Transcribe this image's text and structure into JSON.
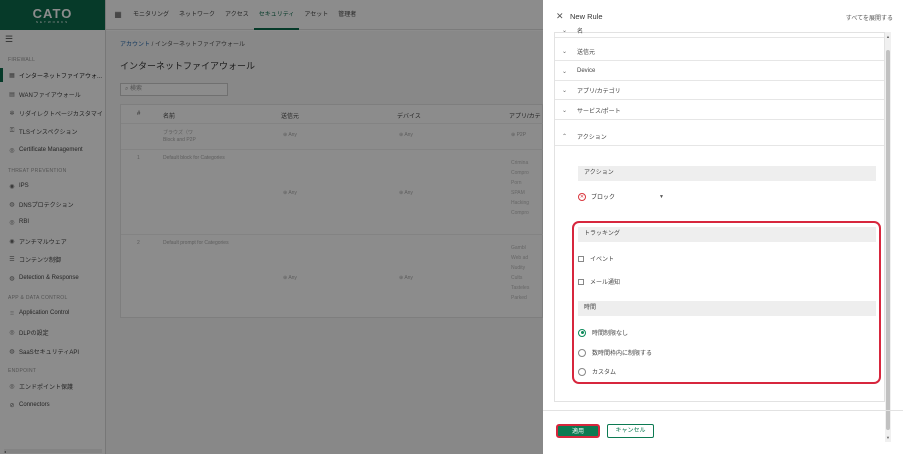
{
  "logo": {
    "name": "CATO",
    "tagline": "NETWORKS"
  },
  "topnav": [
    "モニタリング",
    "ネットワーク",
    "アクセス",
    "セキュリティ",
    "アセット",
    "管理者"
  ],
  "sidebar": {
    "sections": [
      "FIREWALL",
      "THREAT PREVENTION",
      "APP & DATA CONTROL",
      "ENDPOINT"
    ],
    "items": [
      {
        "label": "インターネットファイアウォ...",
        "icon": "firewall-icon",
        "glyph": "▦"
      },
      {
        "label": "WANファイアウォール",
        "icon": "wan-firewall-icon",
        "glyph": "▤"
      },
      {
        "label": "リダイレクトページカスタマイ",
        "icon": "gear-icon",
        "glyph": "✲"
      },
      {
        "label": "TLSインスペクション",
        "icon": "lock-icon",
        "glyph": "⚿"
      },
      {
        "label": "Certificate Management",
        "icon": "certificate-icon",
        "glyph": "◎"
      },
      {
        "label": "IPS",
        "icon": "ips-icon",
        "glyph": "◉"
      },
      {
        "label": "DNSプロテクション",
        "icon": "dns-icon",
        "glyph": "◍"
      },
      {
        "label": "RBI",
        "icon": "rbi-icon",
        "glyph": "◎"
      },
      {
        "label": "アンチマルウェア",
        "icon": "shield-icon",
        "glyph": "◉"
      },
      {
        "label": "コンテンツ制御",
        "icon": "list-icon",
        "glyph": "☰"
      },
      {
        "label": "Detection & Response",
        "icon": "detection-icon",
        "glyph": "◍"
      },
      {
        "label": "Application Control",
        "icon": "app-control-icon",
        "glyph": "⁝⁝"
      },
      {
        "label": "DLPの設定",
        "icon": "dlp-icon",
        "glyph": "◎"
      },
      {
        "label": "SaaSセキュリティAPI",
        "icon": "saas-icon",
        "glyph": "◍"
      },
      {
        "label": "エンドポイント保護",
        "icon": "endpoint-icon",
        "glyph": "◎"
      },
      {
        "label": "Connectors",
        "icon": "connectors-icon",
        "glyph": "⊘"
      }
    ]
  },
  "main": {
    "breadcrumb": {
      "root": "アカウント",
      "separator": " / ",
      "current": "インターネットファイアウォール"
    },
    "title": "インターネットファイアウォール",
    "search_placeholder": "検索",
    "columns": [
      "#",
      "名前",
      "送信元",
      "デバイス",
      "アプリ/カテ"
    ],
    "rows": [
      {
        "num": "",
        "name_line1": "ブラウズ（ワ",
        "name_line2": "Block and P2P",
        "source": "Any",
        "device": "Any",
        "apps": [
          "P2P"
        ]
      },
      {
        "num": "1",
        "name_line1": "Default block for Categories",
        "name_line2": "",
        "source": "Any",
        "device": "Any",
        "apps": [
          "Crimina",
          "Compro",
          "Porn",
          "SPAM",
          "Hacking",
          "Compro"
        ]
      },
      {
        "num": "2",
        "name_line1": "Default prompt for Categories",
        "name_line2": "",
        "source": "Any",
        "device": "Any",
        "apps": [
          "Gambl",
          "Web ad",
          "Nudity",
          "Cults",
          "Tasteles",
          "Parked"
        ]
      }
    ]
  },
  "panel": {
    "title": "New Rule",
    "collapse_all": "すべてを展開する",
    "accordion": [
      {
        "label": "名",
        "state": "collapsed"
      },
      {
        "label": "送信元",
        "state": "collapsed"
      },
      {
        "label": "Device",
        "state": "collapsed"
      },
      {
        "label": "アプリ/カテゴリ",
        "state": "collapsed"
      },
      {
        "label": "サービス/ポート",
        "state": "collapsed"
      },
      {
        "label": "アクション",
        "state": "expanded"
      }
    ],
    "action": {
      "header": "アクション",
      "selected": "ブロック"
    },
    "tracking": {
      "header": "トラッキング",
      "options": [
        {
          "label": "イベント",
          "checked": false
        },
        {
          "label": "メール通知",
          "checked": false
        }
      ]
    },
    "time": {
      "header": "時間",
      "options": [
        {
          "label": "時間制限なし",
          "selected": true
        },
        {
          "label": "数時間枠内に制限する",
          "selected": false
        },
        {
          "label": "カスタム",
          "selected": false
        }
      ]
    },
    "apply_label": "適用",
    "cancel_label": "キャンセル"
  },
  "colors": {
    "brand": "#0c6b4c",
    "highlight": "#d7263d",
    "radio": "#0c8a5a"
  }
}
